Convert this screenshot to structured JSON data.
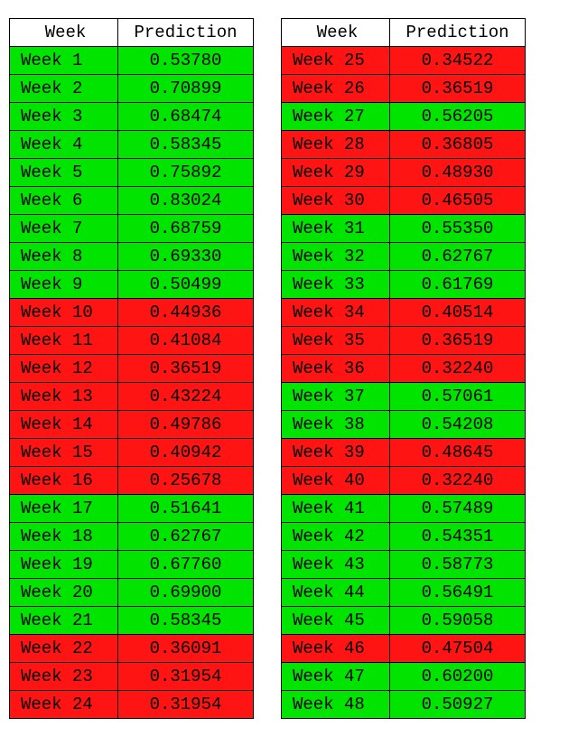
{
  "headers": {
    "week": "Week",
    "prediction": "Prediction"
  },
  "threshold": 0.5,
  "colors": {
    "above": "#00e400",
    "below": "#ff1414"
  },
  "chart_data": {
    "type": "table",
    "title": "",
    "columns": [
      "Week",
      "Prediction"
    ],
    "tables": [
      {
        "rows": [
          {
            "week": "Week 1",
            "prediction": 0.5378
          },
          {
            "week": "Week 2",
            "prediction": 0.70899
          },
          {
            "week": "Week 3",
            "prediction": 0.68474
          },
          {
            "week": "Week 4",
            "prediction": 0.58345
          },
          {
            "week": "Week 5",
            "prediction": 0.75892
          },
          {
            "week": "Week 6",
            "prediction": 0.83024
          },
          {
            "week": "Week 7",
            "prediction": 0.68759
          },
          {
            "week": "Week 8",
            "prediction": 0.6933
          },
          {
            "week": "Week 9",
            "prediction": 0.50499
          },
          {
            "week": "Week 10",
            "prediction": 0.44936
          },
          {
            "week": "Week 11",
            "prediction": 0.41084
          },
          {
            "week": "Week 12",
            "prediction": 0.36519
          },
          {
            "week": "Week 13",
            "prediction": 0.43224
          },
          {
            "week": "Week 14",
            "prediction": 0.49786
          },
          {
            "week": "Week 15",
            "prediction": 0.40942
          },
          {
            "week": "Week 16",
            "prediction": 0.25678
          },
          {
            "week": "Week 17",
            "prediction": 0.51641
          },
          {
            "week": "Week 18",
            "prediction": 0.62767
          },
          {
            "week": "Week 19",
            "prediction": 0.6776
          },
          {
            "week": "Week 20",
            "prediction": 0.699
          },
          {
            "week": "Week 21",
            "prediction": 0.58345
          },
          {
            "week": "Week 22",
            "prediction": 0.36091
          },
          {
            "week": "Week 23",
            "prediction": 0.31954
          },
          {
            "week": "Week 24",
            "prediction": 0.31954
          }
        ]
      },
      {
        "rows": [
          {
            "week": "Week 25",
            "prediction": 0.34522
          },
          {
            "week": "Week 26",
            "prediction": 0.36519
          },
          {
            "week": "Week 27",
            "prediction": 0.56205
          },
          {
            "week": "Week 28",
            "prediction": 0.36805
          },
          {
            "week": "Week 29",
            "prediction": 0.4893
          },
          {
            "week": "Week 30",
            "prediction": 0.46505
          },
          {
            "week": "Week 31",
            "prediction": 0.5535
          },
          {
            "week": "Week 32",
            "prediction": 0.62767
          },
          {
            "week": "Week 33",
            "prediction": 0.61769
          },
          {
            "week": "Week 34",
            "prediction": 0.40514
          },
          {
            "week": "Week 35",
            "prediction": 0.36519
          },
          {
            "week": "Week 36",
            "prediction": 0.3224
          },
          {
            "week": "Week 37",
            "prediction": 0.57061
          },
          {
            "week": "Week 38",
            "prediction": 0.54208
          },
          {
            "week": "Week 39",
            "prediction": 0.48645
          },
          {
            "week": "Week 40",
            "prediction": 0.3224
          },
          {
            "week": "Week 41",
            "prediction": 0.57489
          },
          {
            "week": "Week 42",
            "prediction": 0.54351
          },
          {
            "week": "Week 43",
            "prediction": 0.58773
          },
          {
            "week": "Week 44",
            "prediction": 0.56491
          },
          {
            "week": "Week 45",
            "prediction": 0.59058
          },
          {
            "week": "Week 46",
            "prediction": 0.47504
          },
          {
            "week": "Week 47",
            "prediction": 0.602
          },
          {
            "week": "Week 48",
            "prediction": 0.50927
          }
        ]
      }
    ]
  }
}
